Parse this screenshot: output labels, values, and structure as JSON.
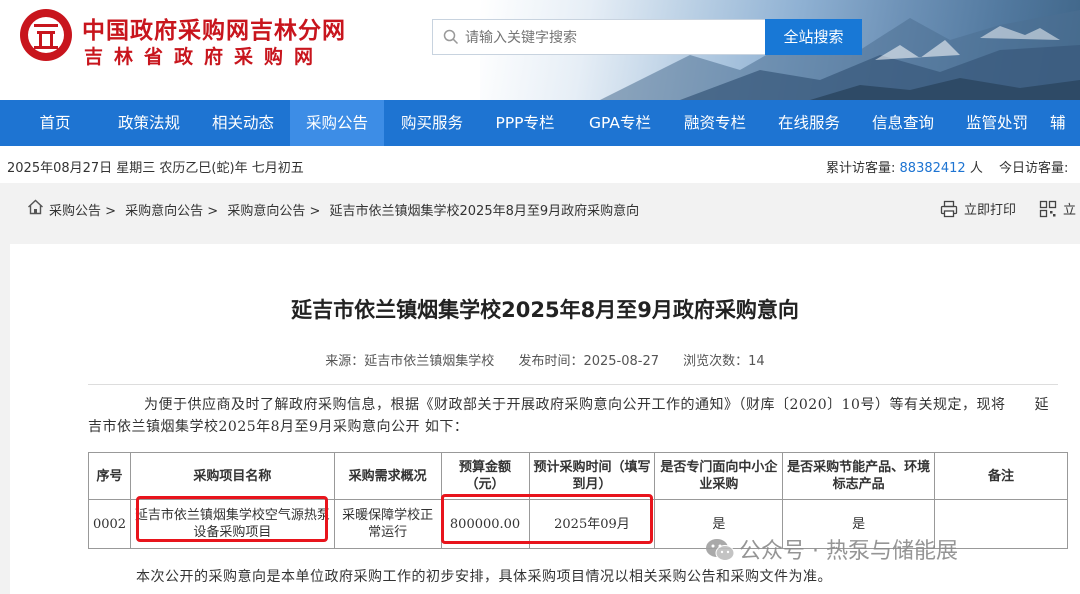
{
  "header": {
    "site_title": "中国政府采购网吉林分网",
    "site_subtitle": "吉林省政府采购网",
    "logo_text": "中国政府采购",
    "search_placeholder": "请输入关键字搜索",
    "search_button": "全站搜索"
  },
  "nav": {
    "items": [
      "首页",
      "政策法规",
      "相关动态",
      "采购公告",
      "购买服务",
      "PPP专栏",
      "GPA专栏",
      "融资专栏",
      "在线服务",
      "信息查询",
      "监管处罚",
      "辅"
    ],
    "active_index": 3
  },
  "infobar": {
    "date": "2025年08月27日 星期三 农历乙巳(蛇)年 七月初五",
    "total_label": "累计访客量:",
    "total_value": "88382412",
    "total_unit": "人",
    "today_label": "今日访客量:"
  },
  "breadcrumb": {
    "items": [
      "采购公告 >",
      "采购意向公告 >",
      "采购意向公告 >",
      "延吉市依兰镇烟集学校2025年8月至9月政府采购意向"
    ],
    "print_label": "立即打印",
    "qr_label": "立"
  },
  "article": {
    "title": "延吉市依兰镇烟集学校2025年8月至9月政府采购意向",
    "source": "来源：延吉市依兰镇烟集学校",
    "publish_time": "发布时间：2025-08-27",
    "views": "浏览次数：14",
    "intro": "为便于供应商及时了解政府采购信息，根据《财政部关于开展政府采购意向公开工作的通知》（财库〔2020〕10号）等有关规定，现将　　延吉市依兰镇烟集学校2025年8月至9月采购意向公开 如下：",
    "table": {
      "headers": [
        "序号",
        "采购项目名称",
        "采购需求概况",
        "预算金额（元）",
        "预计采购时间（填写到月）",
        "是否专门面向中小企业采购",
        "是否采购节能产品、环境标志产品",
        "备注"
      ],
      "rows": [
        [
          "0002",
          "延吉市依兰镇烟集学校空气源热泵设备采购项目",
          "采暖保障学校正常运行",
          "800000.00",
          "2025年09月",
          "是",
          "是",
          ""
        ]
      ]
    },
    "footer": "本次公开的采购意向是本单位政府采购工作的初步安排，具体采购项目情况以相关采购公告和采购文件为准。"
  },
  "watermark": "公众号 · 热泵与储能展",
  "colors": {
    "brand_red": "#c8151d",
    "nav_blue": "#1e74d2",
    "nav_active": "#3d8de6",
    "highlight_red": "#e8141c"
  }
}
